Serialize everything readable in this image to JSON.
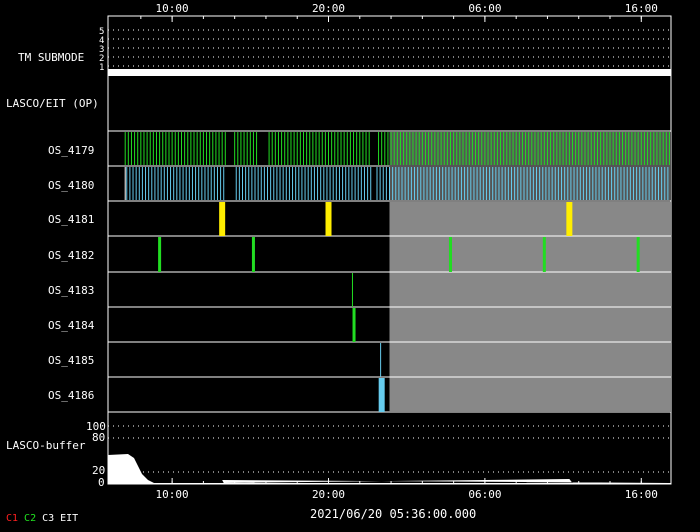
{
  "time_ticks": [
    "10:00",
    "20:00",
    "06:00",
    "16:00"
  ],
  "timestamp": "2021/06/20  05:36:00.000",
  "panels": {
    "tm_submode": {
      "label": "TM SUBMODE",
      "levels": [
        "5",
        "4",
        "3",
        "2",
        "1"
      ]
    },
    "lasco_eit": {
      "label": "LASCO/EIT (OP)"
    },
    "buffer": {
      "label": "LASCO-buffer",
      "levels": [
        "100",
        "80",
        "20",
        "0"
      ]
    }
  },
  "rows": [
    {
      "id": "os_4179",
      "label": "OS_4179"
    },
    {
      "id": "os_4180",
      "label": "OS_4180"
    },
    {
      "id": "os_4181",
      "label": "OS_4181"
    },
    {
      "id": "os_4182",
      "label": "OS_4182"
    },
    {
      "id": "os_4183",
      "label": "OS_4183"
    },
    {
      "id": "os_4184",
      "label": "OS_4184"
    },
    {
      "id": "os_4185",
      "label": "OS_4185"
    },
    {
      "id": "os_4186",
      "label": "OS_4186"
    }
  ],
  "legend": [
    {
      "label": "C1",
      "color": "#ff2020"
    },
    {
      "label": "C2",
      "color": "#20e020"
    },
    {
      "label": "C3",
      "color": "#ffffff"
    },
    {
      "label": "EIT",
      "color": "#ffffff"
    }
  ],
  "colors": {
    "c2_green": "#22dd22",
    "c3_cyan": "#66ccee",
    "yellow": "#ffee00",
    "gray_future": "#888888"
  },
  "chart_data": {
    "type": "timeline",
    "x_range_hours": [
      5.9,
      41.9
    ],
    "x_ticks_hours": [
      10,
      20,
      30,
      40
    ],
    "x_tick_labels": [
      "10:00",
      "20:00",
      "06:00",
      "16:00"
    ],
    "current_time_hours": 23.9,
    "tm_submode_value": 1,
    "events": {
      "os_4181": [
        13.2,
        20.0,
        35.4
      ],
      "os_4182": [
        9.2,
        15.2,
        27.8,
        33.8,
        39.8
      ],
      "os_4183": [
        21.5
      ],
      "os_4184": [
        21.6
      ],
      "os_4185": [
        23.3
      ],
      "os_4186": [
        23.4
      ]
    },
    "buffer_levels": [
      0,
      20,
      80,
      100
    ]
  }
}
